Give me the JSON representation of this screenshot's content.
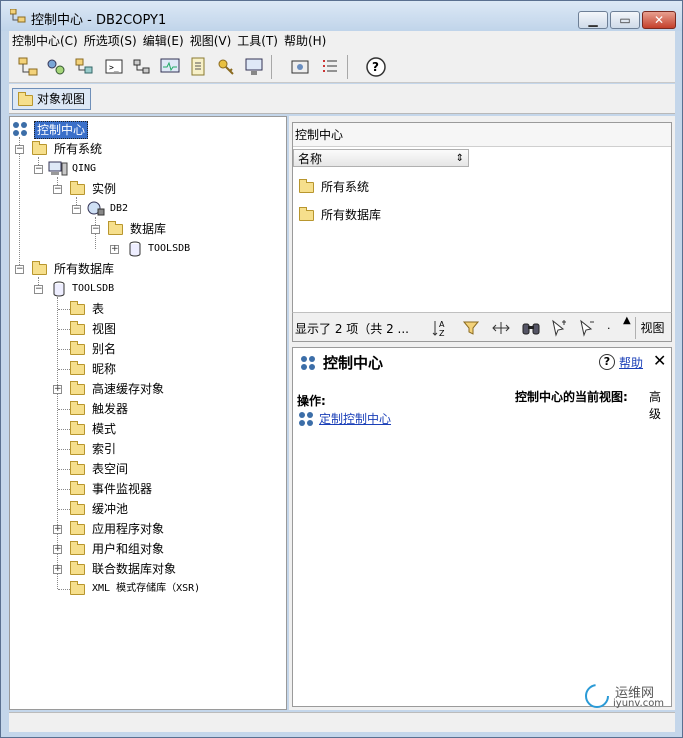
{
  "window": {
    "title": "控制中心 - DB2COPY1"
  },
  "menu": [
    "控制中心(C)",
    "所选项(S)",
    "编辑(E)",
    "视图(V)",
    "工具(T)",
    "帮助(H)"
  ],
  "viewbar": {
    "label": "对象视图"
  },
  "tree": {
    "root": "控制中心",
    "all_systems": "所有系统",
    "qing": "QING",
    "instances": "实例",
    "db2": "DB2",
    "databases": "数据库",
    "toolsdb1": "TOOLSDB",
    "all_databases": "所有数据库",
    "toolsdb2": "TOOLSDB",
    "children": [
      "表",
      "视图",
      "别名",
      "昵称",
      "高速缓存对象",
      "触发器",
      "模式",
      "索引",
      "表空间",
      "事件监视器",
      "缓冲池",
      "应用程序对象",
      "用户和组对象",
      "联合数据库对象",
      "XML 模式存储库（XSR)"
    ]
  },
  "right_list": {
    "header": "控制中心",
    "column": "名称",
    "items": [
      "所有系统",
      "所有数据库"
    ],
    "count": "显示了 2 项（共 2 ...",
    "more_btn": ".",
    "view_btn": "视图"
  },
  "detail": {
    "title": "控制中心",
    "help": "帮助",
    "ops_label": "操作:",
    "current_view_label": "控制中心的当前视图:",
    "current_view_value": "高级",
    "customize_link": "定制控制中心"
  },
  "watermark": {
    "text": "运维网",
    "url_text": "iyunv.com"
  }
}
